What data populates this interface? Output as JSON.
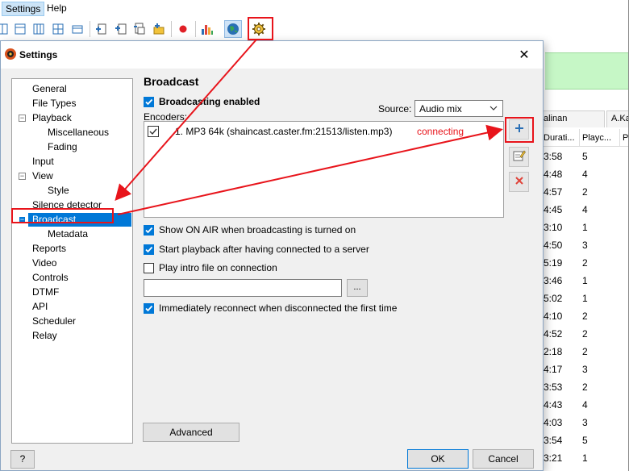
{
  "menubar": {
    "items": [
      "Settings",
      "Help"
    ]
  },
  "toolbar": {
    "icons": [
      "layout-1-icon",
      "layout-2-icon",
      "layout-3-icon",
      "layout-4-icon",
      "add-file-icon",
      "add-folder-icon",
      "add-url-icon",
      "add-playlist-icon",
      "record-icon",
      "statistics-icon",
      "broadcast-globe-icon",
      "settings-gear-icon"
    ]
  },
  "background": {
    "tabs": [
      "alinan",
      "A.Ka"
    ],
    "columns": [
      "Durati...",
      "Playc...",
      "P"
    ],
    "rows": [
      {
        "duration": "3:58",
        "playcount": "5"
      },
      {
        "duration": "4:48",
        "playcount": "4"
      },
      {
        "duration": "4:57",
        "playcount": "2"
      },
      {
        "duration": "4:45",
        "playcount": "4"
      },
      {
        "duration": "3:10",
        "playcount": "1"
      },
      {
        "duration": "4:50",
        "playcount": "3"
      },
      {
        "duration": "5:19",
        "playcount": "2"
      },
      {
        "duration": "3:46",
        "playcount": "1"
      },
      {
        "duration": "5:02",
        "playcount": "1"
      },
      {
        "duration": "4:10",
        "playcount": "2"
      },
      {
        "duration": "4:52",
        "playcount": "2"
      },
      {
        "duration": "2:18",
        "playcount": "2"
      },
      {
        "duration": "4:17",
        "playcount": "3"
      },
      {
        "duration": "3:53",
        "playcount": "2"
      },
      {
        "duration": "4:43",
        "playcount": "4"
      },
      {
        "duration": "4:03",
        "playcount": "3"
      },
      {
        "duration": "3:54",
        "playcount": "5"
      },
      {
        "duration": "3:21",
        "playcount": "1"
      }
    ]
  },
  "dialog": {
    "title": "Settings",
    "tree": [
      {
        "label": "General",
        "level": 0
      },
      {
        "label": "File Types",
        "level": 0
      },
      {
        "label": "Playback",
        "level": 0,
        "expander": "−"
      },
      {
        "label": "Miscellaneous",
        "level": 1
      },
      {
        "label": "Fading",
        "level": 1
      },
      {
        "label": "Input",
        "level": 0
      },
      {
        "label": "View",
        "level": 0,
        "expander": "−"
      },
      {
        "label": "Style",
        "level": 1
      },
      {
        "label": "Silence detector",
        "level": 0
      },
      {
        "label": "Broadcast",
        "level": 0,
        "expander": "−",
        "selected": true
      },
      {
        "label": "Metadata",
        "level": 1
      },
      {
        "label": "Reports",
        "level": 0
      },
      {
        "label": "Video",
        "level": 0
      },
      {
        "label": "Controls",
        "level": 0
      },
      {
        "label": "DTMF",
        "level": 0
      },
      {
        "label": "API",
        "level": 0
      },
      {
        "label": "Scheduler",
        "level": 0
      },
      {
        "label": "Relay",
        "level": 0
      }
    ],
    "panel": {
      "title": "Broadcast",
      "broadcasting_enabled": "Broadcasting enabled",
      "source_label": "Source:",
      "source_value": "Audio mix",
      "encoders_label": "Encoders:",
      "encoders": [
        {
          "name": "1. MP3 64k (shaincast.caster.fm:21513/listen.mp3)",
          "status": "connecting",
          "checked": true
        }
      ],
      "options": [
        {
          "label": "Show ON AIR when broadcasting is turned on",
          "checked": true
        },
        {
          "label": "Start playback after having connected to a server",
          "checked": true
        },
        {
          "label": "Play intro file on connection",
          "checked": false
        }
      ],
      "intro_file_value": "",
      "browse_label": "...",
      "reconnect_label": "Immediately reconnect when disconnected the first time",
      "advanced_label": "Advanced"
    },
    "buttons": {
      "help": "?",
      "ok": "OK",
      "cancel": "Cancel"
    }
  },
  "colors": {
    "selection": "#0078d7",
    "annotation": "#e8141b",
    "status": "#e8141b"
  }
}
